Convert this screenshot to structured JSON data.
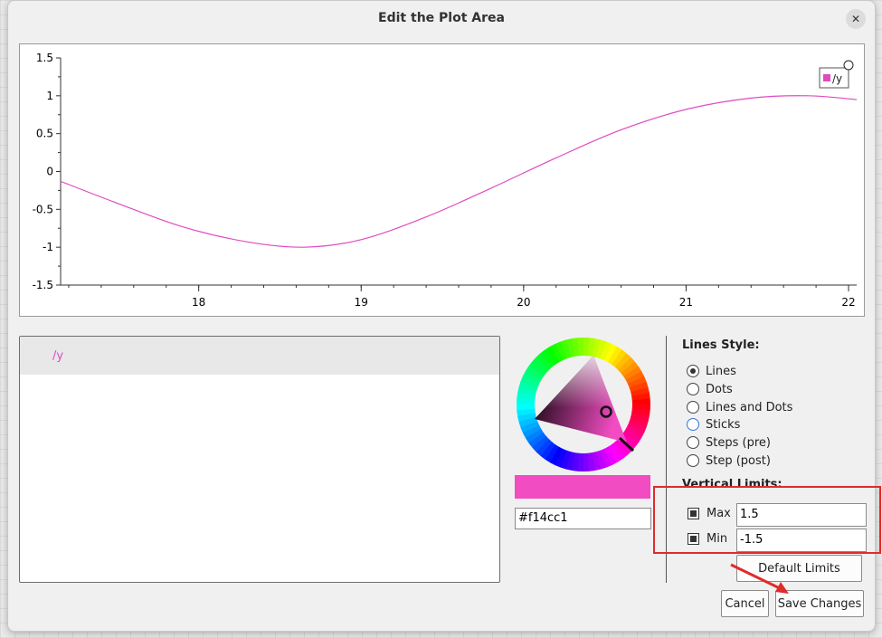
{
  "dialog": {
    "title": "Edit the Plot Area",
    "close_icon": "close-icon"
  },
  "plot": {
    "y_ticks": [
      "1.5",
      "1",
      "0.5",
      "0",
      "-0.5",
      "-1",
      "-1.5"
    ],
    "x_ticks": [
      "18",
      "19",
      "20",
      "21",
      "22"
    ],
    "legend_label": "/y",
    "line_color": "#e04bc0"
  },
  "chart_data": {
    "type": "line",
    "x_range": [
      17.15,
      22.05
    ],
    "ylim": [
      -1.5,
      1.5
    ],
    "series": [
      {
        "name": "/y",
        "x": [
          17.15,
          17.5,
          17.9,
          18.3,
          18.65,
          19.0,
          19.4,
          19.8,
          20.2,
          20.6,
          21.0,
          21.4,
          21.75,
          22.05
        ],
        "y": [
          -0.13,
          -0.42,
          -0.73,
          -0.93,
          -1.0,
          -0.9,
          -0.6,
          -0.22,
          0.18,
          0.55,
          0.82,
          0.97,
          1.0,
          0.95
        ]
      }
    ]
  },
  "series_list": {
    "items": [
      "/y"
    ]
  },
  "color": {
    "hex": "#f14cc1"
  },
  "lines_style": {
    "title": "Lines Style:",
    "options": [
      "Lines",
      "Dots",
      "Lines and Dots",
      "Sticks",
      "Steps (pre)",
      "Step (post)"
    ],
    "selected": "Lines"
  },
  "vertical_limits": {
    "title": "Vertical Limits:",
    "max_label": "Max",
    "max_value": "1.5",
    "min_label": "Min",
    "min_value": "-1.5",
    "default_button": "Default Limits"
  },
  "buttons": {
    "cancel": "Cancel",
    "save": "Save Changes"
  },
  "annotation_colors": {
    "highlight": "#e02b2b"
  }
}
